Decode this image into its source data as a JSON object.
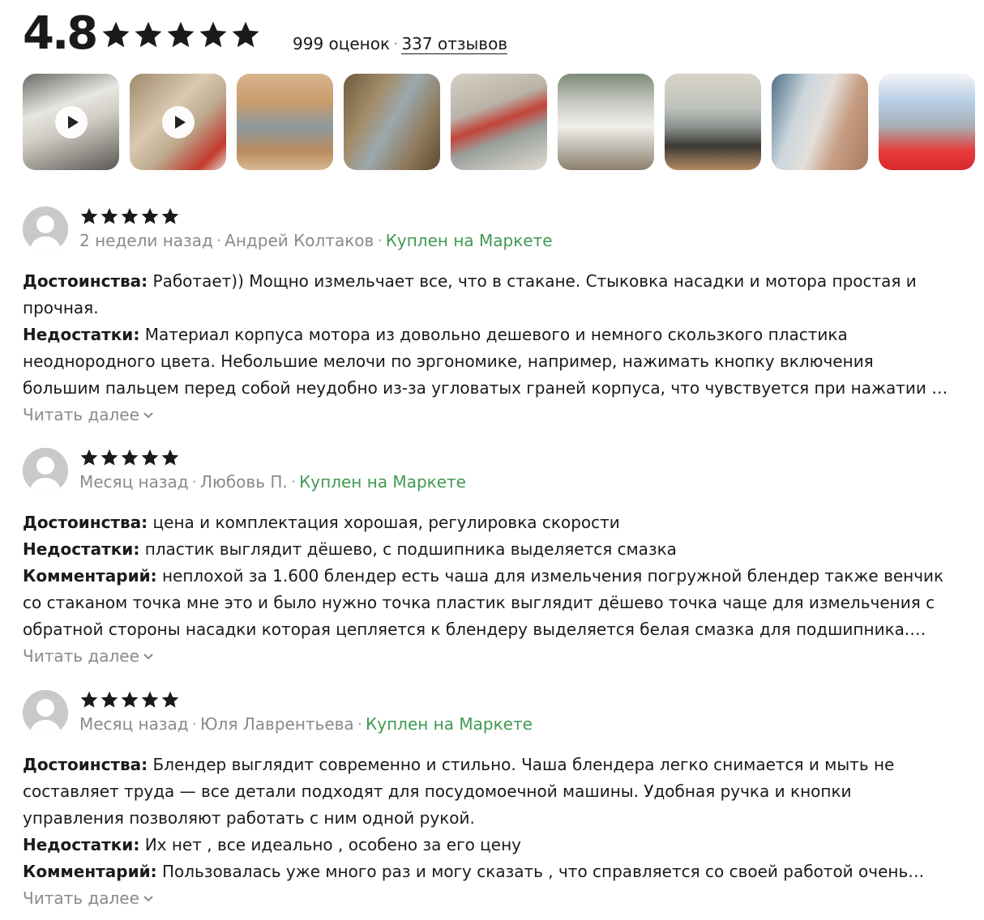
{
  "summary": {
    "rating": "4.8",
    "stars_filled": 5,
    "ratings_count": "999 оценок",
    "separator": "·",
    "reviews_count": "337 отзывов"
  },
  "media": [
    {
      "type": "video",
      "icon": "play-icon"
    },
    {
      "type": "video",
      "icon": "play-icon"
    },
    {
      "type": "photo"
    },
    {
      "type": "photo"
    },
    {
      "type": "photo"
    },
    {
      "type": "photo"
    },
    {
      "type": "photo"
    },
    {
      "type": "photo"
    },
    {
      "type": "photo"
    }
  ],
  "reviews": [
    {
      "stars": 5,
      "date": "2 недели назад",
      "author": "Андрей Колтаков",
      "badge": "Куплен на Маркете",
      "pros_label": "Достоинства:",
      "pros": "Работает)) Мощно измельчает все, что в стакане. Стыковка насадки и мотора простая и прочная.",
      "cons_label": "Недостатки:",
      "cons": "Материал корпуса мотора из довольно дешевого и немного скользкого пластика неоднородного цвета. Небольшие мелочи по эргономике, например, нажимать кнопку включения большим пальцем перед собой неудобно из-за угловатых граней корпуса, что чувствуется при нажатии на кнопку. Корпус в местах соединения",
      "comment_label": "",
      "comment": "",
      "read_more": "Читать далее"
    },
    {
      "stars": 5,
      "date": "Месяц назад",
      "author": "Любовь П.",
      "badge": "Куплен на Маркете",
      "pros_label": "Достоинства:",
      "pros": "цена и комплектация хорошая, регулировка скорости",
      "cons_label": "Недостатки:",
      "cons": "пластик выглядит дёшево, с подшипника выделяется смазка",
      "comment_label": "Комментарий:",
      "comment": "неплохой за 1.600 блендер есть чаша для измельчения погружной блендер также венчик со стаканом точка мне это и было нужно точка пластик выглядит дёшево точка чаще для измельчения с обратной стороны насадки которая цепляется к блендеру выделяется белая смазка для подшипника. немного беспокоит",
      "read_more": "Читать далее"
    },
    {
      "stars": 5,
      "date": "Месяц назад",
      "author": "Юля Лаврентьева",
      "badge": "Куплен на Маркете",
      "pros_label": "Достоинства:",
      "pros": "Блендер выглядит современно и стильно. Чаша блендера легко снимается и мыть не составляет труда — все детали подходят для посудомоечной машины. Удобная ручка и кнопки управления позволяют работать с ним одной рукой.",
      "cons_label": "Недостатки:",
      "cons": "Их нет , все идеально , особено за его цену",
      "comment_label": "Комментарий:",
      "comment": "Пользовалась уже много раз и могу сказать , что справляется со своей работой очень хорошо",
      "read_more": "Читать далее"
    }
  ],
  "colors": {
    "text": "#1a1a1a",
    "muted": "#8a8a8a",
    "bought": "#3f9a52",
    "star": "#1a1a1a",
    "avatar_bg": "#c9c9c9"
  }
}
